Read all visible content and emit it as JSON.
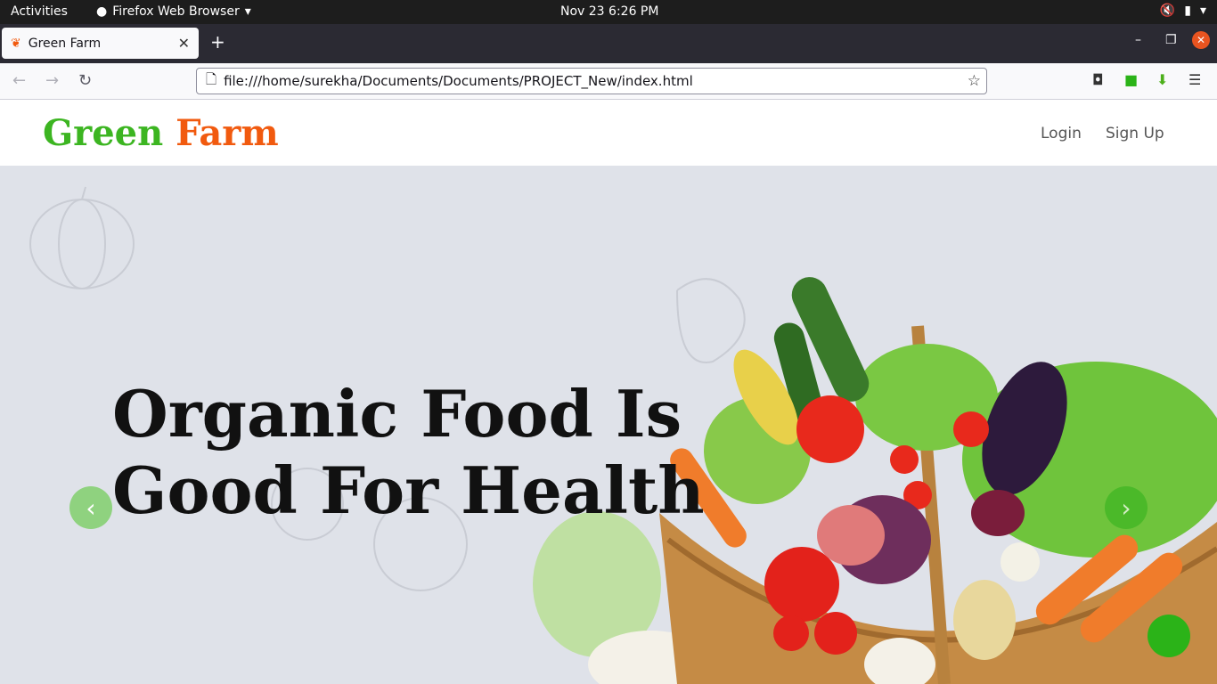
{
  "system": {
    "activities": "Activities",
    "app_name": "Firefox Web Browser",
    "clock": "Nov 23   6:26 PM"
  },
  "browser": {
    "tab_title": "Green Farm",
    "url": "file:///home/surekha/Documents/Documents/PROJECT_New/index.html"
  },
  "site": {
    "logo_green": "Green",
    "logo_orange": "Farm",
    "nav": [
      "Login",
      "Sign Up"
    ],
    "hero_title": "Organic Food Is Good For Health"
  },
  "colors": {
    "brand_green": "#3cb521",
    "brand_orange": "#f15a0f",
    "hero_bg": "#dfe2e9"
  }
}
